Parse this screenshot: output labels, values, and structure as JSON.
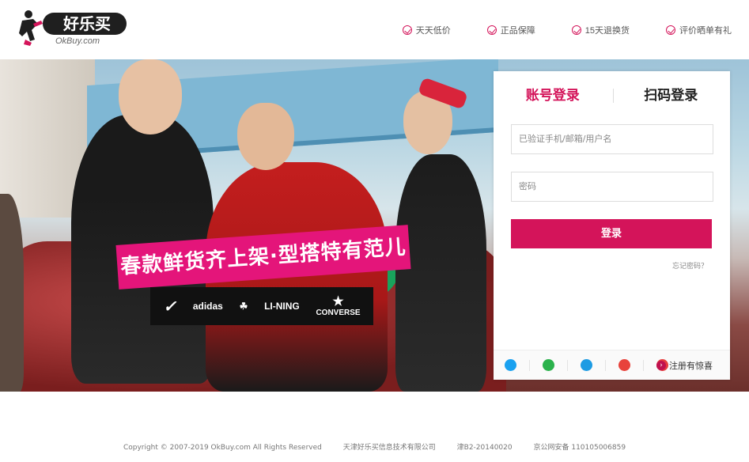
{
  "header": {
    "logo_text": "好乐买",
    "logo_sub": "OkBuy.com",
    "promises": [
      "天天低价",
      "正品保障",
      "15天退换货",
      "评价晒单有礼"
    ]
  },
  "banner": {
    "slogan": "春款鲜货齐上架·型搭特有范儿",
    "brands": {
      "nike": "✓",
      "adidas": "adidas",
      "originals": "☘",
      "lining": "LI-NING",
      "converse_star": "★",
      "converse": "CONVERSE"
    }
  },
  "login": {
    "tab_account": "账号登录",
    "tab_qr": "扫码登录",
    "username_placeholder": "已验证手机/邮箱/用户名",
    "password_placeholder": "密码",
    "login_button": "登录",
    "forgot": "忘记密码？",
    "register": "注册有惊喜",
    "social_colors": [
      "#1aa1f0",
      "#2bb24c",
      "#1d9be3",
      "#e8423b",
      "#e73d3d"
    ],
    "social_icons": [
      "qq-icon",
      "wechat-icon",
      "alipay-icon",
      "weibo-icon",
      "other-login-icon"
    ]
  },
  "footer": {
    "copyright": "Copyright © 2007-2019 OkBuy.com All Rights Reserved",
    "company": "天津好乐买信息技术有限公司",
    "icp": "津B2-20140020",
    "police": "京公网安备 110105006859"
  },
  "colors": {
    "accent": "#d4145a"
  }
}
